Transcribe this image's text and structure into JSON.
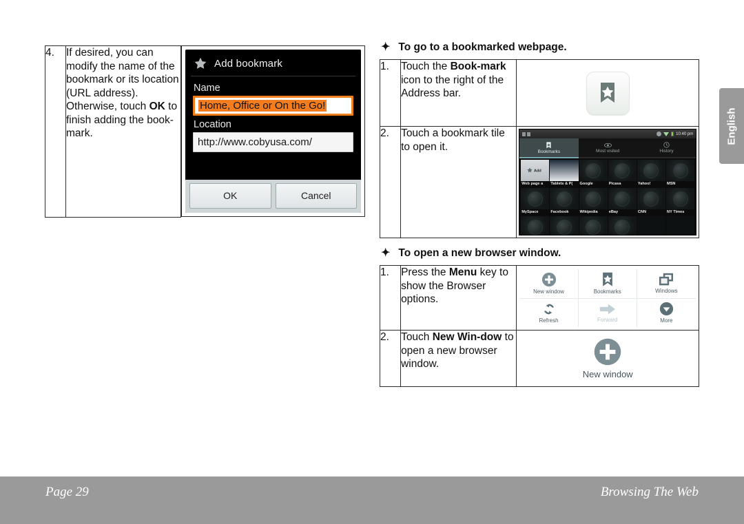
{
  "left_step": {
    "number": "4.",
    "text_parts": [
      {
        "t": "If desired, you can modify the name of the bookmark or its location (URL address). Otherwise, touch ",
        "b": false
      },
      {
        "t": "OK",
        "b": true
      },
      {
        "t": " to finish adding the book-mark.",
        "b": false
      }
    ],
    "plain": "If desired, you can modify the name of the bookmark or its location (URL address). Otherwise, touch OK to finish adding the book-mark."
  },
  "dialog": {
    "icon": "star-icon",
    "title": "Add bookmark",
    "name_label": "Name",
    "name_value": "Home, Office or On the Go!",
    "location_label": "Location",
    "location_value": "http://www.cobyusa.com/",
    "ok_label": "OK",
    "cancel_label": "Cancel",
    "highlight_color": "#f47d20"
  },
  "section_bookmarked": {
    "bullet": "✦",
    "heading": "To go to a bookmarked webpage.",
    "rows": [
      {
        "num": "1.",
        "parts": [
          {
            "t": "Touch the ",
            "b": false
          },
          {
            "t": "Book-mark",
            "b": true
          },
          {
            "t": " icon to the right of the Address bar.",
            "b": false
          }
        ]
      },
      {
        "num": "2.",
        "parts": [
          {
            "t": "Touch a bookmark tile to open it.",
            "b": false
          }
        ]
      }
    ]
  },
  "bookmarks_screenshot": {
    "status": {
      "time": "10:40 pm"
    },
    "tabs": [
      {
        "label": "Bookmarks",
        "icon": "bookmark-star-icon",
        "active": true
      },
      {
        "label": "Most visited",
        "icon": "eye-icon",
        "active": false
      },
      {
        "label": "History",
        "icon": "clock-icon",
        "active": false
      }
    ],
    "tiles": [
      {
        "label": "Web page a",
        "thumb": "add-bookmark-thumb"
      },
      {
        "label": "Tablets & P(",
        "thumb": "tablets-thumb"
      },
      {
        "label": "Google",
        "thumb": "globe"
      },
      {
        "label": "Picasa",
        "thumb": "globe"
      },
      {
        "label": "Yahoo!",
        "thumb": "globe"
      },
      {
        "label": "MSN",
        "thumb": "globe"
      },
      {
        "label": "MySpace",
        "thumb": "globe"
      },
      {
        "label": "Facebook",
        "thumb": "globe"
      },
      {
        "label": "Wikipedia",
        "thumb": "globe"
      },
      {
        "label": "eBay",
        "thumb": "globe"
      },
      {
        "label": "CNN",
        "thumb": "globe"
      },
      {
        "label": "NY Times",
        "thumb": "globe"
      }
    ],
    "add_tile_label": "Add"
  },
  "section_newwindow": {
    "bullet": "✦",
    "heading": "To open a new browser window.",
    "rows": [
      {
        "num": "1.",
        "parts": [
          {
            "t": "Press the ",
            "b": false
          },
          {
            "t": "Menu",
            "b": true
          },
          {
            "t": " key to show the Browser options.",
            "b": false
          }
        ]
      },
      {
        "num": "2.",
        "parts": [
          {
            "t": "Touch ",
            "b": false
          },
          {
            "t": "New Win-dow",
            "b": true
          },
          {
            "t": " to open a new browser window.",
            "b": false
          }
        ]
      }
    ]
  },
  "browser_menu": {
    "items": [
      {
        "label": "New window",
        "icon": "plus-circle-icon",
        "disabled": false
      },
      {
        "label": "Bookmarks",
        "icon": "bookmark-star-icon",
        "disabled": false
      },
      {
        "label": "Windows",
        "icon": "windows-icon",
        "disabled": false
      },
      {
        "label": "Refresh",
        "icon": "refresh-icon",
        "disabled": false
      },
      {
        "label": "Forward",
        "icon": "arrow-right-icon",
        "disabled": true
      },
      {
        "label": "More",
        "icon": "chevron-down-circle-icon",
        "disabled": false
      }
    ],
    "new_window_label": "New window"
  },
  "side_tab": {
    "label": "English"
  },
  "footer": {
    "page": "Page 29",
    "section": "Browsing The Web",
    "bar_color": "#9a9a9a"
  }
}
